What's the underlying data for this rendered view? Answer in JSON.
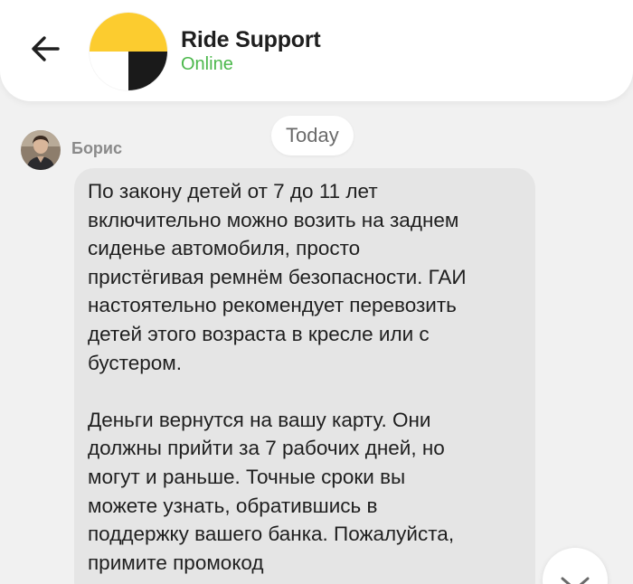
{
  "header": {
    "title": "Ride Support",
    "status": "Online",
    "status_color": "#4cb84c",
    "back_icon": "arrow-left-icon",
    "logo_colors": [
      "#fccc2f",
      "#1a1a1a",
      "#ffffff"
    ]
  },
  "chat": {
    "date_label": "Today",
    "sender_name": "Борис",
    "message": {
      "paragraph1": "По закону детей от 7 до 11 лет\nвключительно можно возить на заднем\nсиденье автомобиля, просто\nпристёгивая ремнём безопасности. ГАИ\nнастоятельно рекомендует перевозить\nдетей этого возраста в кресле или с\nбустером.",
      "paragraph2": "Деньги вернутся на вашу карту. Они\nдолжны прийти за 7 рабочих дней, но\nмогут и раньше. Точные сроки вы\nможете узнать, обратившись в\nподдержку вашего банка. Пожалуйста,\nпримите промокод"
    },
    "scroll_icon": "chevron-down-icon"
  }
}
